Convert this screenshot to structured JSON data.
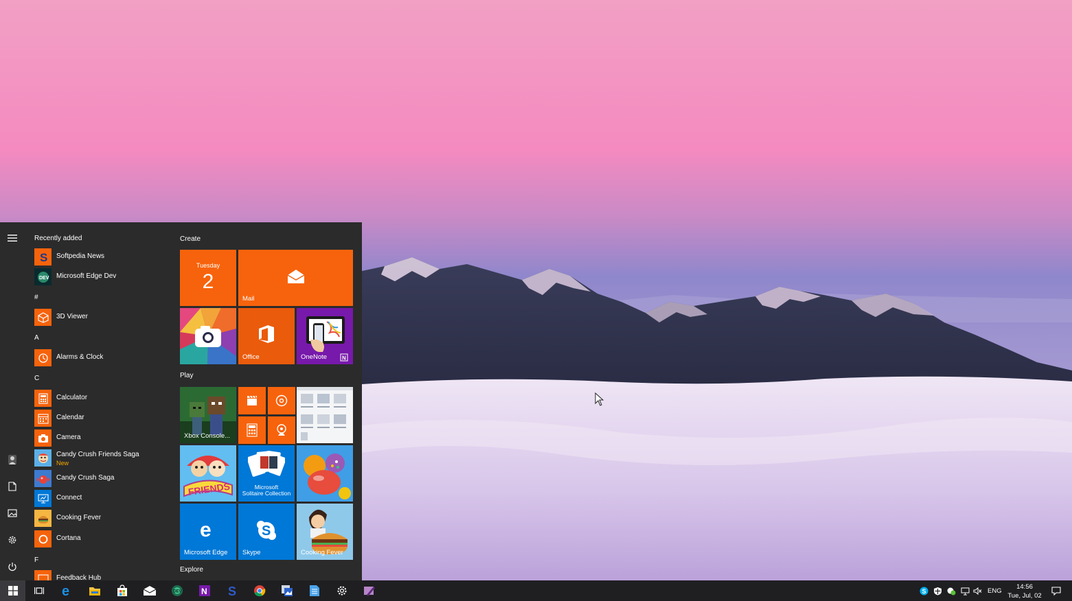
{
  "start_menu": {
    "rail": {
      "icons": [
        "hamburger-icon",
        "user-icon",
        "documents-icon",
        "pictures-icon",
        "settings-icon",
        "power-icon"
      ]
    },
    "app_list": {
      "recently_added": "Recently added",
      "groups": [
        "#",
        "A",
        "C",
        "F"
      ],
      "apps": [
        {
          "label": "Softpedia News",
          "icon": "softpedia-icon"
        },
        {
          "label": "Microsoft Edge Dev",
          "icon": "edge-dev-icon"
        },
        {
          "label": "3D Viewer",
          "icon": "3d-viewer-icon"
        },
        {
          "label": "Alarms & Clock",
          "icon": "alarm-icon"
        },
        {
          "label": "Calculator",
          "icon": "calculator-icon"
        },
        {
          "label": "Calendar",
          "icon": "calendar-icon"
        },
        {
          "label": "Camera",
          "icon": "camera-icon"
        },
        {
          "label": "Candy Crush Friends Saga",
          "sub": "New",
          "icon": "candy-crush-friends-icon"
        },
        {
          "label": "Candy Crush Saga",
          "icon": "candy-crush-icon"
        },
        {
          "label": "Connect",
          "icon": "connect-icon"
        },
        {
          "label": "Cooking Fever",
          "icon": "cooking-fever-icon"
        },
        {
          "label": "Cortana",
          "icon": "cortana-icon"
        },
        {
          "label": "Feedback Hub",
          "icon": "feedback-hub-icon"
        }
      ]
    },
    "tiles": {
      "sections": [
        "Create",
        "Play",
        "Explore"
      ],
      "calendar": {
        "day_name": "Tuesday",
        "day_number": "2"
      },
      "mail": "Mail",
      "office": "Office",
      "onenote": "OneNote",
      "xbox": "Xbox Console...",
      "solitaire_line1": "Microsoft",
      "solitaire_line2": "Solitaire Collection",
      "edge": "Microsoft Edge",
      "skype": "Skype",
      "cooking": "Cooking Fever"
    },
    "colors": {
      "accent": "#f7630c",
      "blue": "#0078d7",
      "menu_bg": "#2b2b2b"
    }
  },
  "taskbar": {
    "apps": [
      "windows-start-icon",
      "task-view-icon",
      "edge-icon",
      "file-explorer-icon",
      "store-icon",
      "mail-icon",
      "edge-dev-icon",
      "onenote-icon",
      "softpedia-icon",
      "chrome-icon",
      "photos-app-icon",
      "notepad-icon",
      "settings-icon",
      "snip-icon"
    ],
    "tray": {
      "icons": [
        "skype-tray-icon",
        "defender-icon",
        "network-status-icon",
        "wifi-icon",
        "volume-mute-icon"
      ],
      "lang": "ENG",
      "time": "14:56",
      "date": "Tue, Jul, 02"
    },
    "notification_icon": "action-center-icon"
  }
}
